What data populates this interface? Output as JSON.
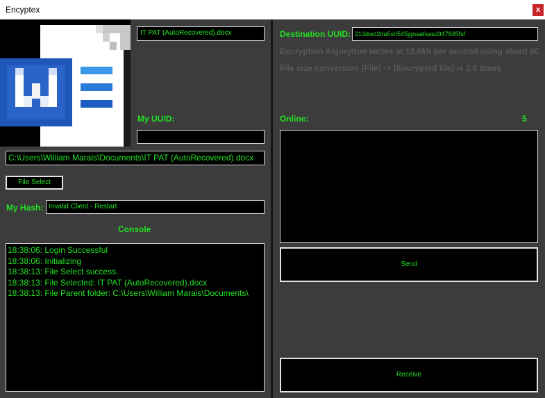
{
  "window": {
    "title": "Encyptex",
    "close_label": "x"
  },
  "left": {
    "file_name_display": "IT PAT (AutoRecovered).docx",
    "my_uuid_label": "My UUID:",
    "my_uuid_value": "",
    "file_path": "C:\\Users\\William Marais\\Documents\\IT PAT (AutoRecovered).docx",
    "file_select_label": "File Select",
    "my_hash_label": "My Hash:",
    "my_hash_value": "Invalid Client - Restart",
    "console_label": "Console",
    "console_lines": [
      "18:38:06: Login Successful",
      "18:38:06: Initializing",
      "18:38:13: File Select success.",
      "18:38:13: File Selected: IT PAT (AutoRecovered).docx",
      "18:38:13: File Parent folder: C:\\Users\\William Marais\\Documents\\"
    ]
  },
  "right": {
    "destination_uuid_label": "Destination UUID:",
    "destination_uuid_value": "213dwd2da5sh545jgnaafsasd347845fsf",
    "encryption_info": "Encryption Algorythm writes at 12.6kb per second using about 60...",
    "conversion_info": "File size conversion [File] -> [Encrypted file] is 2.6 times",
    "online_label": "Online:",
    "online_count": "5",
    "message_value": "",
    "send_label": "Send",
    "receive_label": "Receive"
  },
  "colors": {
    "accent_green": "#22e022",
    "panel_bg": "#3c3c3c",
    "close_red": "#c8262b"
  },
  "icons": {
    "file_icon": "word-document-icon"
  }
}
